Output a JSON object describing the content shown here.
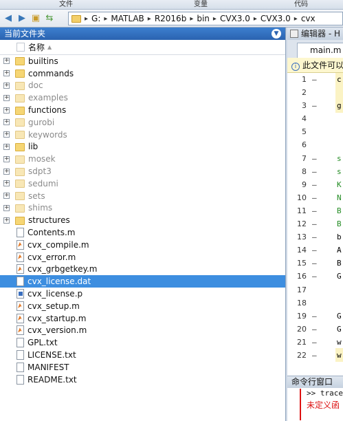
{
  "ribbon": {
    "tab1": "文件",
    "tab2": "变量",
    "tab3": "代码"
  },
  "toolbar": {
    "back_icon": "arrow-left-icon",
    "forward_icon": "arrow-right-icon",
    "up_icon": "folder-up-icon",
    "browse_icon": "browse-folder-icon"
  },
  "path": [
    "G:",
    "MATLAB",
    "R2016b",
    "bin",
    "CVX3.0",
    "CVX3.0",
    "cvx"
  ],
  "current_folder": {
    "title": "当前文件夹",
    "column_name": "名称",
    "items": [
      {
        "name": "builtins",
        "kind": "folder",
        "expandable": true,
        "dim": false
      },
      {
        "name": "commands",
        "kind": "folder",
        "expandable": true,
        "dim": false
      },
      {
        "name": "doc",
        "kind": "folder",
        "expandable": true,
        "dim": true
      },
      {
        "name": "examples",
        "kind": "folder",
        "expandable": true,
        "dim": true
      },
      {
        "name": "functions",
        "kind": "folder",
        "expandable": true,
        "dim": false
      },
      {
        "name": "gurobi",
        "kind": "folder",
        "expandable": true,
        "dim": true
      },
      {
        "name": "keywords",
        "kind": "folder",
        "expandable": true,
        "dim": true
      },
      {
        "name": "lib",
        "kind": "folder",
        "expandable": true,
        "dim": false
      },
      {
        "name": "mosek",
        "kind": "folder",
        "expandable": true,
        "dim": true
      },
      {
        "name": "sdpt3",
        "kind": "folder",
        "expandable": true,
        "dim": true
      },
      {
        "name": "sedumi",
        "kind": "folder",
        "expandable": true,
        "dim": true
      },
      {
        "name": "sets",
        "kind": "folder",
        "expandable": true,
        "dim": true
      },
      {
        "name": "shims",
        "kind": "folder",
        "expandable": true,
        "dim": true
      },
      {
        "name": "structures",
        "kind": "folder",
        "expandable": true,
        "dim": false
      },
      {
        "name": "Contents.m",
        "kind": "doc",
        "expandable": false,
        "dim": false
      },
      {
        "name": "cvx_compile.m",
        "kind": "mfile",
        "expandable": false,
        "dim": false
      },
      {
        "name": "cvx_error.m",
        "kind": "mfile",
        "expandable": false,
        "dim": false
      },
      {
        "name": "cvx_grbgetkey.m",
        "kind": "mfile",
        "expandable": false,
        "dim": false
      },
      {
        "name": "cvx_license.dat",
        "kind": "doc",
        "expandable": false,
        "dim": false,
        "selected": true
      },
      {
        "name": "cvx_license.p",
        "kind": "pfile",
        "expandable": false,
        "dim": false
      },
      {
        "name": "cvx_setup.m",
        "kind": "mfile",
        "expandable": false,
        "dim": false
      },
      {
        "name": "cvx_startup.m",
        "kind": "mfile",
        "expandable": false,
        "dim": false
      },
      {
        "name": "cvx_version.m",
        "kind": "mfile",
        "expandable": false,
        "dim": false
      },
      {
        "name": "GPL.txt",
        "kind": "doc",
        "expandable": false,
        "dim": false
      },
      {
        "name": "LICENSE.txt",
        "kind": "doc",
        "expandable": false,
        "dim": false
      },
      {
        "name": "MANIFEST",
        "kind": "doc",
        "expandable": false,
        "dim": false
      },
      {
        "name": "README.txt",
        "kind": "doc",
        "expandable": false,
        "dim": false
      }
    ]
  },
  "editor": {
    "title": "编辑器 - H",
    "tab": "main.m",
    "info": "此文件可以",
    "lines": [
      {
        "n": "1",
        "dash": "–",
        "text": "c",
        "comment": false
      },
      {
        "n": "2",
        "dash": "",
        "text": "",
        "comment": false
      },
      {
        "n": "3",
        "dash": "–",
        "text": "g",
        "comment": false
      },
      {
        "n": "4",
        "dash": "",
        "text": "",
        "comment": false
      },
      {
        "n": "5",
        "dash": "",
        "text": "",
        "comment": false
      },
      {
        "n": "6",
        "dash": "",
        "text": "",
        "comment": false
      },
      {
        "n": "7",
        "dash": "–",
        "text": "s",
        "comment": true
      },
      {
        "n": "8",
        "dash": "–",
        "text": "s",
        "comment": true
      },
      {
        "n": "9",
        "dash": "–",
        "text": "K",
        "comment": true
      },
      {
        "n": "10",
        "dash": "–",
        "text": "N",
        "comment": true
      },
      {
        "n": "11",
        "dash": "–",
        "text": "B",
        "comment": true
      },
      {
        "n": "12",
        "dash": "–",
        "text": "B",
        "comment": true
      },
      {
        "n": "13",
        "dash": "–",
        "text": "b",
        "comment": false
      },
      {
        "n": "14",
        "dash": "–",
        "text": "A",
        "comment": false
      },
      {
        "n": "15",
        "dash": "–",
        "text": "B",
        "comment": false
      },
      {
        "n": "16",
        "dash": "–",
        "text": "G",
        "comment": false
      },
      {
        "n": "17",
        "dash": "",
        "text": "",
        "comment": false
      },
      {
        "n": "18",
        "dash": "",
        "text": "",
        "comment": false
      },
      {
        "n": "19",
        "dash": "–",
        "text": "G",
        "comment": false
      },
      {
        "n": "20",
        "dash": "–",
        "text": "G",
        "comment": false
      },
      {
        "n": "21",
        "dash": "–",
        "text": "w",
        "comment": false
      },
      {
        "n": "22",
        "dash": "–",
        "text": "w",
        "comment": false
      }
    ]
  },
  "command_window": {
    "title": "命令行窗口",
    "line": ">> trace",
    "error": "未定义函"
  }
}
